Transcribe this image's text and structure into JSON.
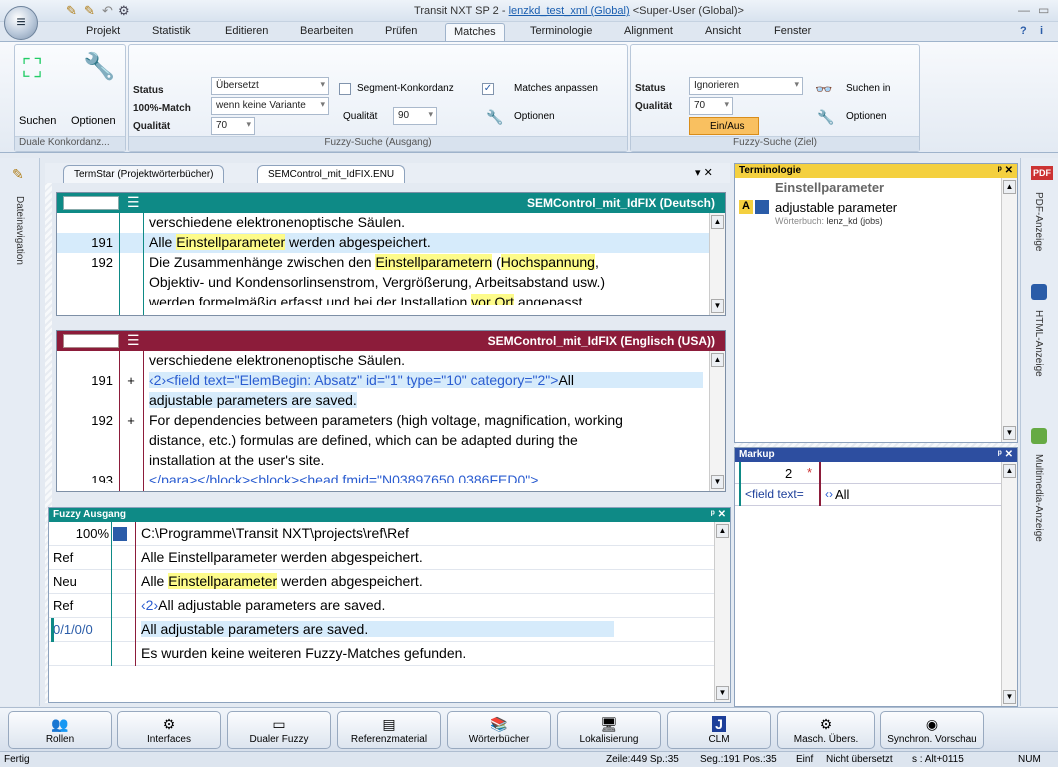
{
  "window": {
    "title_prefix": "Transit NXT SP 2 - ",
    "title_project": "lenzkd_test_xml (Global)",
    "title_suffix": " <Super-User (Global)>"
  },
  "tabs": [
    "Projekt",
    "Statistik",
    "Editieren",
    "Bearbeiten",
    "Prüfen",
    "Matches",
    "Terminologie",
    "Alignment",
    "Ansicht",
    "Fenster"
  ],
  "ribbon": {
    "duale": {
      "suchen": "Suchen",
      "optionen": "Optionen",
      "label": "Duale Konkordanz..."
    },
    "fuzzy_src": {
      "status": "Status",
      "match100": "100%-Match",
      "qualitaet": "Qualität",
      "status_val": "Übersetzt",
      "match_val": "wenn keine Variante",
      "qual_val": "70",
      "segkonk": "Segment-Konkordanz",
      "qual2": "Qualität",
      "qual2_val": "90",
      "matches_anpassen": "Matches anpassen",
      "optionen": "Optionen",
      "label": "Fuzzy-Suche (Ausgang)",
      "check": "✓"
    },
    "fuzzy_tgt": {
      "status": "Status",
      "qualitaet": "Qualität",
      "status_val": "Ignorieren",
      "qual_val": "70",
      "einaus": "Ein/Aus",
      "suchen_in": "Suchen in",
      "optionen": "Optionen",
      "label": "Fuzzy-Suche (Ziel)"
    }
  },
  "left_sidebar": {
    "label": "Dateinavigation"
  },
  "right_sidebar": {
    "pdf": "PDF-Anzeige",
    "html": "HTML-Anzeige",
    "mm": "Multimedia-Anzeige",
    "pdf_icon": "PDF"
  },
  "doc_tabs": [
    "TermStar (Projektwörterbücher)",
    "SEMControl_mit_IdFIX.ENU"
  ],
  "source": {
    "header": "SEMControl_mit_IdFIX (Deutsch)",
    "rows": [
      {
        "num": "",
        "mark": "",
        "parts": [
          {
            "t": "verschiedene elektronenoptische Säulen."
          }
        ]
      },
      {
        "num": "191",
        "mark": "",
        "blue": true,
        "parts": [
          {
            "t": "Alle "
          },
          {
            "t": "Einstellparameter",
            "hl": true
          },
          {
            "t": " werden abgespeichert."
          }
        ]
      },
      {
        "num": "192",
        "mark": "",
        "parts": [
          {
            "t": "Die Zusammenhänge zwischen den "
          },
          {
            "t": "Einstellparametern",
            "hl": true
          },
          {
            "t": " ("
          },
          {
            "t": "Hochspannung",
            "hl": true
          },
          {
            "t": ","
          }
        ]
      },
      {
        "num": "",
        "mark": "",
        "parts": [
          {
            "t": "Objektiv- und Kondensorlinsenstrom, Vergrößerung, Arbeitsabstand usw.)"
          }
        ]
      },
      {
        "num": "",
        "mark": "",
        "parts": [
          {
            "t": "werden formelmäßig erfasst und bei der Installation "
          },
          {
            "t": "vor Ort",
            "hl": true
          },
          {
            "t": " angepasst."
          }
        ]
      }
    ]
  },
  "target": {
    "header": "SEMControl_mit_IdFIX (Englisch (USA))",
    "rows": [
      {
        "num": "",
        "mark": "",
        "parts": [
          {
            "t": "verschiedene elektronenoptische Säulen."
          }
        ]
      },
      {
        "num": "191",
        "mark": "+",
        "blue": true,
        "parts": [
          {
            "t": "‹2›<field text=\"ElemBegin: Absatz\" id=\"1\" type=\"10\" category=\"2\">",
            "tag": true
          },
          {
            "t": "All"
          }
        ]
      },
      {
        "num": "",
        "mark": "",
        "blue": true,
        "parts": [
          {
            "t": "adjustable parameters are saved."
          }
        ]
      },
      {
        "num": "192",
        "mark": "+",
        "parts": [
          {
            "t": "For dependencies between parameters (high voltage, magnification, working"
          }
        ]
      },
      {
        "num": "",
        "mark": "",
        "parts": [
          {
            "t": "distance, etc.) formulas are defined, which can be adapted during the"
          }
        ]
      },
      {
        "num": "",
        "mark": "",
        "parts": [
          {
            "t": "installation at the user's site."
          }
        ]
      },
      {
        "num": "193",
        "mark": "",
        "parts": [
          {
            "t": "</para></block><block><head fmid=\"N03897650.0386FED0\">",
            "tag": true
          }
        ]
      }
    ]
  },
  "terminology": {
    "title": "Terminologie",
    "term_src": "Einstellparameter",
    "term_tgt": "adjustable parameter",
    "dict_label": "Wörterbuch:",
    "dict_val": "lenz_kd (jobs)",
    "badge": "A"
  },
  "markup": {
    "title": "Markup",
    "num": "2",
    "mark": "*",
    "field": "<field text=",
    "tag": "‹›",
    "all": "All"
  },
  "fuzzy": {
    "title": "Fuzzy Ausgang",
    "rows": [
      {
        "c1": "100%",
        "text": "C:\\Programme\\Transit NXT\\projects\\ref\\Ref"
      },
      {
        "c1": "Ref",
        "text": "Alle Einstellparameter werden abgespeichert."
      },
      {
        "c1": "Neu",
        "parts": [
          {
            "t": "Alle "
          },
          {
            "t": "Einstellparameter",
            "hl": true
          },
          {
            "t": " werden abgespeichert."
          }
        ]
      },
      {
        "c1": "Ref",
        "parts": [
          {
            "t": "‹2›",
            "tag": true
          },
          {
            "t": "All adjustable parameters are saved."
          }
        ]
      },
      {
        "c1": "0/1/0/0",
        "blue": true,
        "text": "All adjustable parameters are saved."
      },
      {
        "c1": "",
        "text": "Es wurden keine weiteren Fuzzy-Matches gefunden."
      }
    ]
  },
  "bottom_buttons": [
    "Rollen",
    "Interfaces",
    "Dualer Fuzzy",
    "Referenzmaterial",
    "Wörterbücher",
    "Lokalisierung",
    "CLM",
    "Masch. Übers.",
    "Synchron. Vorschau"
  ],
  "bottom_icons": [
    "people-icon",
    "gears-icon",
    "dual-icon",
    "docs-icon",
    "books-icon",
    "monitor-icon",
    "J",
    "mt-icon",
    "eye-icon"
  ],
  "status": {
    "left": "Fertig",
    "pos": "Zeile:449 Sp.:35",
    "seg": "Seg.:191 Pos.:35",
    "einf": "Einf",
    "state": "Nicht übersetzt",
    "key": "s : Alt+0115",
    "num": "NUM"
  },
  "colors": {
    "source_header": "#0e8a86",
    "target_header": "#8c1c3a",
    "term_header": "#f4d03f",
    "markup_header": "#2d4ea0",
    "fuzzy_header": "#0e8a86",
    "highlight": "#fdfb8a",
    "segment_blue": "#d6ebfb"
  }
}
